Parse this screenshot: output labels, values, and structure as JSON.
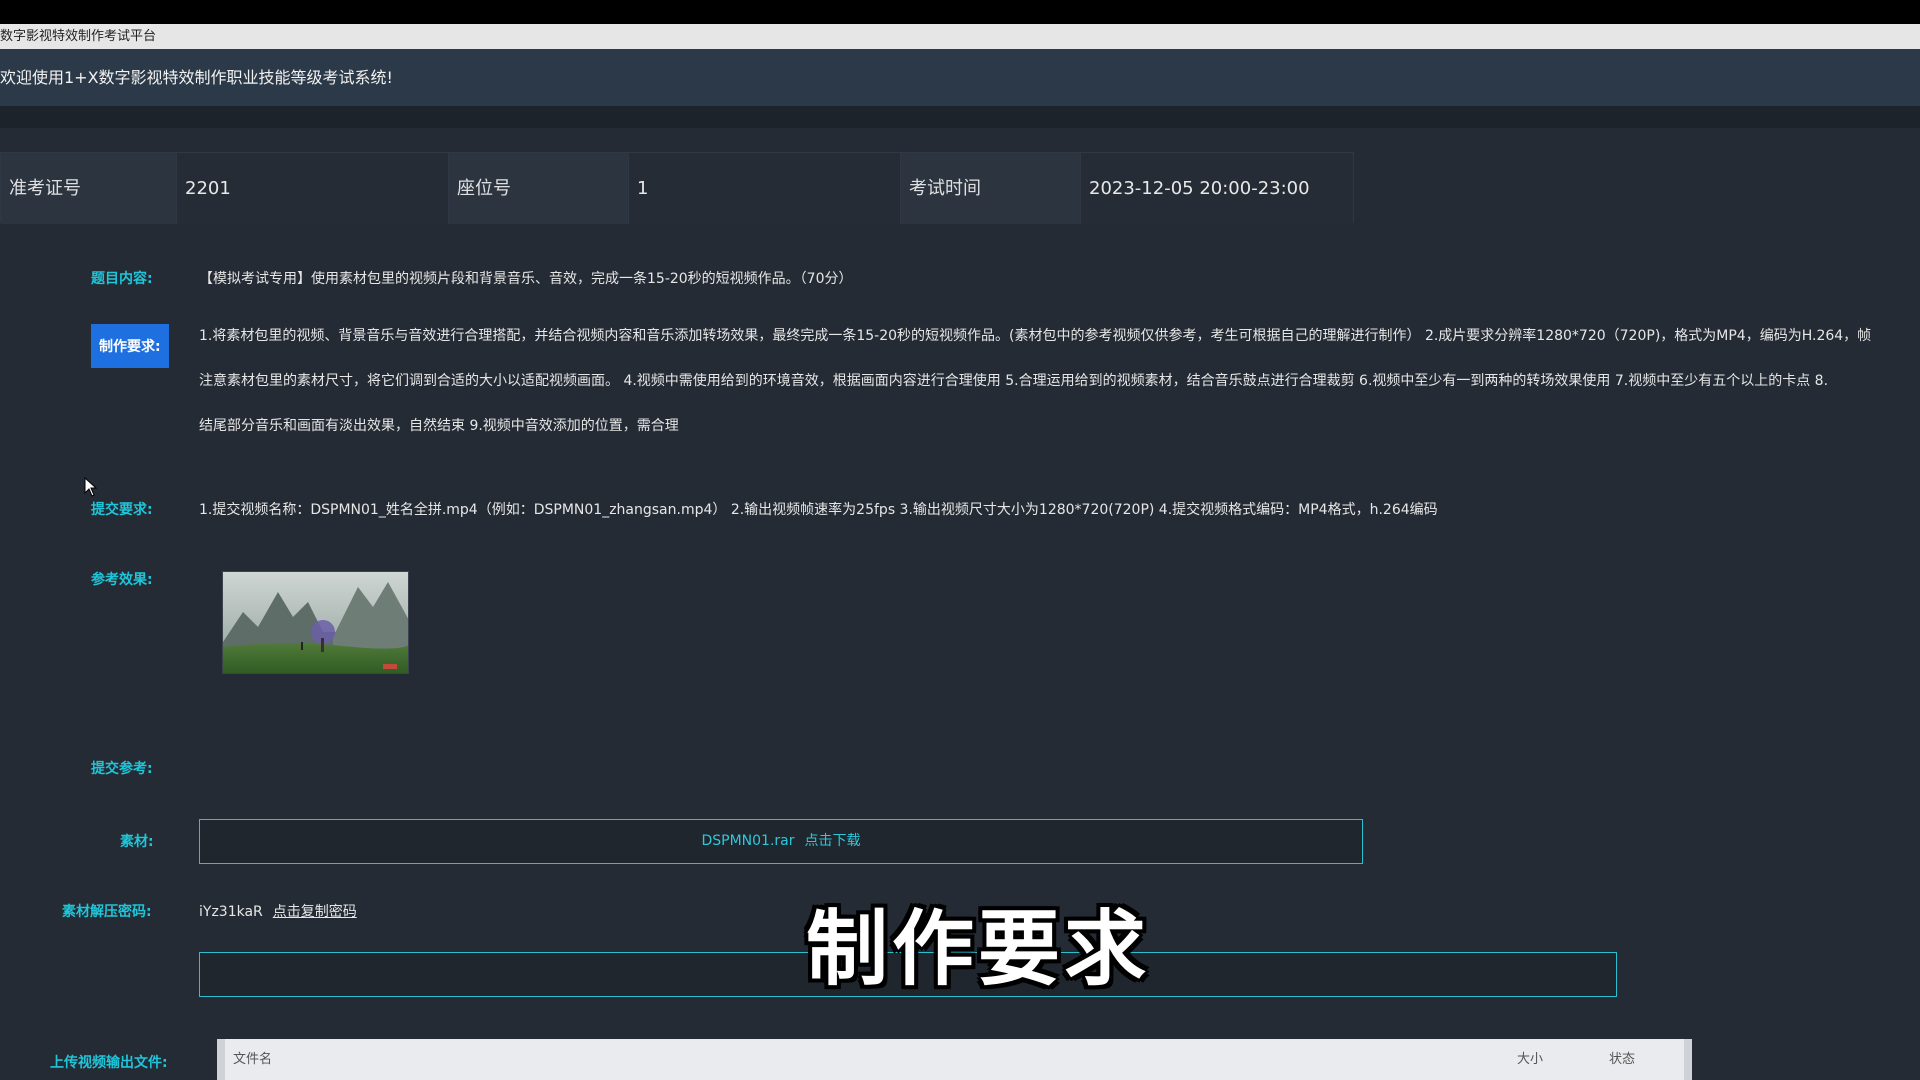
{
  "window": {
    "title": "数字影视特效制作考试平台"
  },
  "welcome": "欢迎使用1+X数字影视特效制作职业技能等级考试系统!",
  "info": {
    "ticket_label": "准考证号",
    "ticket_value": "2201",
    "seat_label": "座位号",
    "seat_value": "1",
    "time_label": "考试时间",
    "time_value": "2023-12-05 20:00-23:00"
  },
  "topic": {
    "label": "题目内容:",
    "text": "【模拟考试专用】使用素材包里的视频片段和背景音乐、音效，完成一条15-20秒的短视频作品。（70分）"
  },
  "requirements": {
    "label": "制作要求:",
    "lines": [
      "1.将素材包里的视频、背景音乐与音效进行合理搭配，并结合视频内容和音乐添加转场效果，最终完成一条15-20秒的短视频作品。(素材包中的参考视频仅供参考，考生可根据自己的理解进行制作） 2.成片要求分辨率1280*720（720P)，格式为MP4，编码为H.264，帧",
      "注意素材包里的素材尺寸，将它们调到合适的大小以适配视频画面。 4.视频中需使用给到的环境音效，根据画面内容进行合理使用 5.合理运用给到的视频素材，结合音乐鼓点进行合理裁剪 6.视频中至少有一到两种的转场效果使用 7.视频中至少有五个以上的卡点 8.",
      "结尾部分音乐和画面有淡出效果，自然结束 9.视频中音效添加的位置，需合理"
    ]
  },
  "submit": {
    "label": "提交要求:",
    "text": "1.提交视频名称：DSPMN01_姓名全拼.mp4（例如：DSPMN01_zhangsan.mp4） 2.输出视频帧速率为25fps 3.输出视频尺寸大小为1280*720(720P) 4.提交视频格式编码：MP4格式，h.264编码"
  },
  "reference_label": "参考效果:",
  "submit_ref_label": "提交参考:",
  "material": {
    "label": "素材:",
    "filename": "DSPMN01.rar",
    "link": "点击下载"
  },
  "password": {
    "label": "素材解压密码:",
    "value": "iYz31kaR",
    "copy": "点击复制密码"
  },
  "upload": {
    "label": "上传视频输出文件:",
    "columns": [
      "文件名",
      "大小",
      "状态"
    ]
  },
  "subtitle": "制作要求",
  "colors": {
    "accent": "#1fc5d9",
    "highlight": "#1e6fe0",
    "background": "#242b34"
  }
}
